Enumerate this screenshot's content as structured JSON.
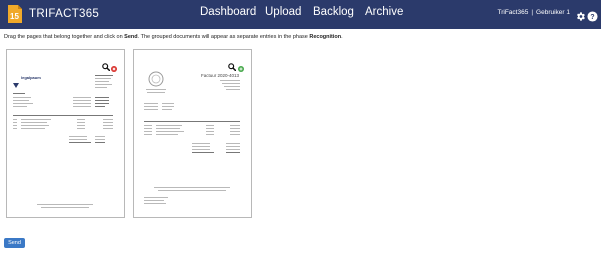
{
  "app": {
    "logo_text": "TRIFACT365",
    "brand_color": "#2b3a6b",
    "accent_color": "#f0a92a"
  },
  "nav": {
    "dashboard": "Dashboard",
    "upload": "Upload",
    "backlog": "Backlog",
    "archive": "Archive"
  },
  "user": {
    "company": "TriFact365",
    "separator": "|",
    "name": "Gebruiker 1"
  },
  "icons": {
    "settings": "gear-icon",
    "help": "help-icon",
    "preview": "magnifier-icon",
    "remove": "close-circle-icon",
    "add": "plus-circle-icon"
  },
  "instructions": {
    "part1": "Drag the pages that belong together and click on ",
    "send_word": "Send",
    "part2": ". The grouped documents will appear as separate entries in the phase ",
    "phase_word": "Recognition",
    "part3": "."
  },
  "cards": [
    {
      "document_logo_text": "legalpaum",
      "status_color": "#d9302b"
    },
    {
      "document_title": "Factuur 2020-4013",
      "status_color": "#46a84b"
    }
  ],
  "send_button": {
    "label": "Send",
    "color": "#3b79c6"
  }
}
